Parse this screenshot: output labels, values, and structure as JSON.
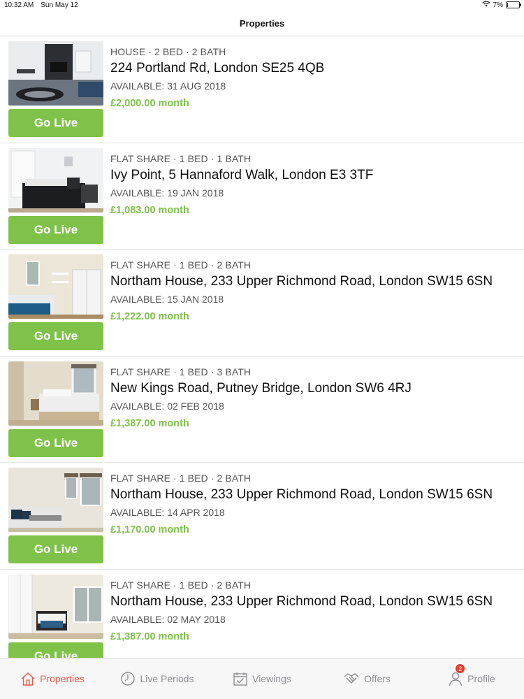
{
  "status_bar": {
    "time": "10:32 AM",
    "date": "Sun May 12",
    "battery_percent": "7%",
    "battery_level": 0.07
  },
  "nav": {
    "title": "Properties"
  },
  "go_live_label": "Go Live",
  "properties": [
    {
      "meta": "HOUSE · 2 BED · 2 BATH",
      "address": "224 Portland Rd, London SE25 4QB",
      "available": "AVAILABLE: 31 AUG 2018",
      "price": "£2,000.00 month"
    },
    {
      "meta": "FLAT SHARE · 1 BED · 1 BATH",
      "address": "Ivy Point, 5 Hannaford Walk, London E3 3TF",
      "available": "AVAILABLE: 19 JAN 2018",
      "price": "£1,083.00 month"
    },
    {
      "meta": "FLAT SHARE · 1 BED · 2 BATH",
      "address": "Northam House, 233 Upper Richmond Road, London SW15 6SN",
      "available": "AVAILABLE: 15 JAN 2018",
      "price": "£1,222.00 month"
    },
    {
      "meta": "FLAT SHARE · 1 BED · 3 BATH",
      "address": "New Kings Road, Putney Bridge, London SW6 4RJ",
      "available": "AVAILABLE: 02 FEB 2018",
      "price": "£1,387.00 month"
    },
    {
      "meta": "FLAT SHARE · 1 BED · 2 BATH",
      "address": "Northam House, 233 Upper Richmond Road, London SW15 6SN",
      "available": "AVAILABLE: 14 APR 2018",
      "price": "£1,170.00 month"
    },
    {
      "meta": "FLAT SHARE · 1 BED · 2 BATH",
      "address": "Northam House, 233 Upper Richmond Road, London SW15 6SN",
      "available": "AVAILABLE: 02 MAY 2018",
      "price": "£1,387.00 month"
    }
  ],
  "tabs": [
    {
      "label": "Properties",
      "icon": "house-icon",
      "active": true
    },
    {
      "label": "Live Periods",
      "icon": "clock-icon",
      "active": false
    },
    {
      "label": "Viewings",
      "icon": "calendar-check-icon",
      "active": false
    },
    {
      "label": "Offers",
      "icon": "handshake-icon",
      "active": false
    },
    {
      "label": "Profile",
      "icon": "person-icon",
      "active": false,
      "badge": "2"
    }
  ],
  "colors": {
    "accent_green": "#7fc24a",
    "active_tab": "#e55a4e",
    "badge_red": "#e53b30"
  }
}
